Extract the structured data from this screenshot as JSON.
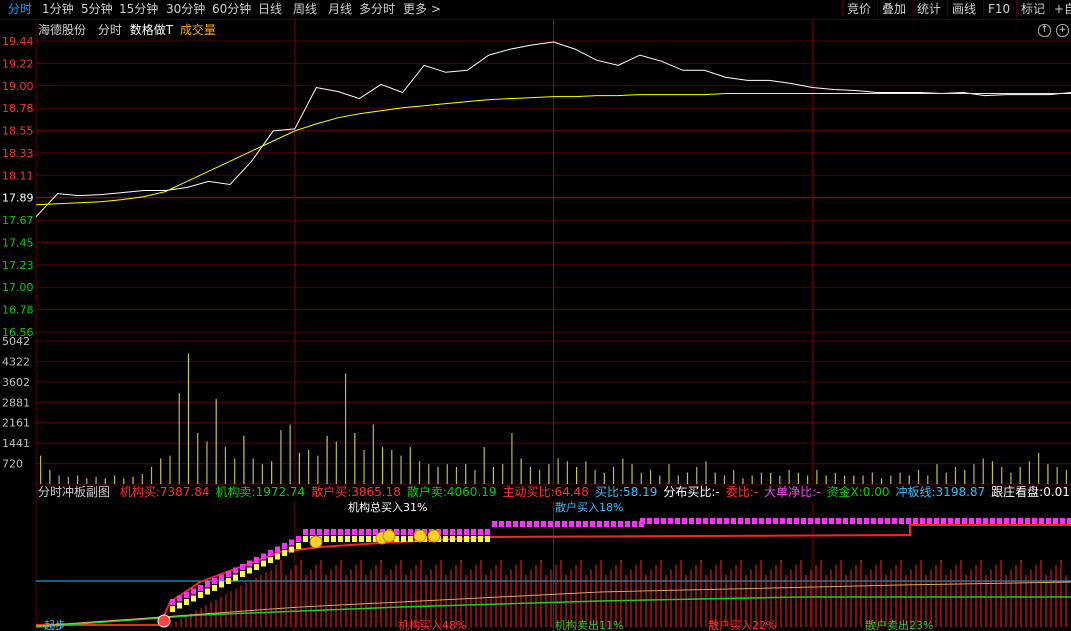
{
  "toolbar": {
    "tabs": [
      {
        "label": "分时",
        "active": true
      },
      {
        "label": "1分钟"
      },
      {
        "label": "5分钟"
      },
      {
        "label": "15分钟"
      },
      {
        "label": "30分钟"
      },
      {
        "label": "60分钟"
      },
      {
        "label": "日线"
      },
      {
        "label": "周线"
      },
      {
        "label": "月线"
      },
      {
        "label": "多分时"
      },
      {
        "label": "更多 >"
      }
    ],
    "right_buttons": [
      {
        "label": "竞价"
      },
      {
        "label": "叠加"
      },
      {
        "label": "统计"
      },
      {
        "label": "画线"
      },
      {
        "label": "F10"
      },
      {
        "label": "标记"
      },
      {
        "label": "+自"
      }
    ]
  },
  "header": {
    "stock_name": "海德股份",
    "mode": "分时",
    "indicator": "数格做T",
    "volume_label": "成交量",
    "button_up": "↑",
    "button_plus": "+"
  },
  "price_axis": [
    "19.44",
    "19.22",
    "19.00",
    "18.78",
    "18.55",
    "18.33",
    "18.11",
    "17.89",
    "17.67",
    "17.45",
    "17.23",
    "17.00",
    "16.78",
    "16.56"
  ],
  "volume_axis": [
    "5042",
    "4322",
    "3602",
    "2881",
    "2161",
    "1441",
    "720"
  ],
  "sub_header": {
    "title": "分时冲板副图",
    "items": [
      {
        "label": "机构买:",
        "value": "7387.84",
        "color": "#ff3030"
      },
      {
        "label": "机构卖:",
        "value": "1972.74",
        "color": "#00d000"
      },
      {
        "label": "散户买:",
        "value": "3865.18",
        "color": "#ff3030"
      },
      {
        "label": "散户卖:",
        "value": "4060.19",
        "color": "#00d000"
      },
      {
        "label": "主动买比:",
        "value": "64.48",
        "color": "#ff3030"
      },
      {
        "label": "买比:",
        "value": "58.19",
        "color": "#30c0ff"
      },
      {
        "label": "分布买比:",
        "value": "-",
        "color": "#ffffff"
      },
      {
        "label": "委比:",
        "value": "-",
        "color": "#ff3030"
      },
      {
        "label": "大单净比:",
        "value": "-",
        "color": "#ff40ff"
      },
      {
        "label": "资金X:",
        "value": "0.00",
        "color": "#00d000"
      },
      {
        "label": "冲板线:",
        "value": "3198.87",
        "color": "#30c0ff"
      },
      {
        "label": "跟庄看盘:",
        "value": "0.01",
        "color": "#ffffff"
      },
      {
        "label": "主力",
        "value": "",
        "color": "#ff40ff"
      }
    ]
  },
  "annotations": {
    "inst_total_buy": "机构总买入31%",
    "retail_total_buy": "散户买入18%",
    "inst_buy": "机构买入48%",
    "inst_sell": "机构卖出11%",
    "retail_buy": "散户买入22%",
    "retail_sell": "散户卖出23%",
    "start_label": "起步"
  },
  "chart_data": [
    {
      "type": "line",
      "name": "intraday-price",
      "ylim": [
        16.56,
        19.44
      ],
      "prev_close": 17.89,
      "x": [
        0,
        5,
        10,
        15,
        20,
        25,
        30,
        35,
        40,
        45,
        50,
        55,
        60,
        65,
        70,
        75,
        80,
        85,
        90,
        95,
        100,
        105,
        110,
        115,
        120,
        125,
        130,
        135,
        140,
        145,
        150,
        155,
        160,
        165,
        170,
        175,
        180,
        185,
        190,
        195,
        200,
        205,
        210,
        215,
        220,
        225,
        230,
        235,
        240
      ],
      "series": [
        {
          "values": [
            17.7,
            17.93,
            17.91,
            17.92,
            17.94,
            17.96,
            17.96,
            17.99,
            18.05,
            18.02,
            18.25,
            18.55,
            18.57,
            18.98,
            18.94,
            18.87,
            19.01,
            18.93,
            19.2,
            19.13,
            19.15,
            19.3,
            19.36,
            19.4,
            19.43,
            19.36,
            19.25,
            19.2,
            19.3,
            19.24,
            19.15,
            19.15,
            19.08,
            19.05,
            19.05,
            19.02,
            18.98,
            18.96,
            18.95,
            18.93,
            18.93,
            18.93,
            18.92,
            18.93,
            18.9,
            18.91,
            18.91,
            18.91,
            18.93
          ],
          "color": "#ffffff"
        },
        {
          "values": [
            17.82,
            17.83,
            17.84,
            17.85,
            17.87,
            17.9,
            17.95,
            18.05,
            18.15,
            18.25,
            18.35,
            18.45,
            18.55,
            18.62,
            18.68,
            18.72,
            18.75,
            18.78,
            18.8,
            18.82,
            18.84,
            18.86,
            18.87,
            18.88,
            18.89,
            18.89,
            18.9,
            18.9,
            18.91,
            18.91,
            18.91,
            18.91,
            18.92,
            18.92,
            18.92,
            18.92,
            18.92,
            18.92,
            18.92,
            18.92,
            18.92,
            18.92,
            18.92,
            18.92,
            18.92,
            18.92,
            18.92,
            18.92,
            18.92
          ],
          "color": "#ffff00"
        }
      ]
    },
    {
      "type": "bar",
      "name": "volume",
      "ylim": [
        0,
        5042
      ],
      "values": [
        1000,
        500,
        300,
        250,
        300,
        200,
        250,
        200,
        300,
        200,
        250,
        350,
        600,
        900,
        1000,
        3200,
        4600,
        1800,
        1500,
        3000,
        1300,
        900,
        1700,
        900,
        700,
        800,
        1900,
        2100,
        1100,
        1200,
        1000,
        1700,
        1500,
        3900,
        1800,
        1200,
        2100,
        1300,
        1200,
        1000,
        1300,
        800,
        700,
        600,
        700,
        600,
        700,
        500,
        1300,
        600,
        700,
        1800,
        900,
        600,
        500,
        700,
        900,
        800,
        600,
        800,
        500,
        400,
        600,
        900,
        700,
        400,
        500,
        300,
        700,
        300,
        400,
        600,
        800,
        400,
        300,
        500,
        200,
        300,
        400,
        400,
        300,
        500,
        400,
        300,
        500,
        300,
        400,
        300,
        300,
        300,
        400,
        200,
        300,
        400,
        300,
        500,
        300,
        700,
        400,
        600,
        500,
        700,
        900,
        800,
        600,
        400,
        600,
        800,
        1100,
        700,
        600,
        500
      ]
    },
    {
      "type": "line",
      "name": "sub-indicator",
      "series": [
        {
          "name": "冲板线",
          "values": [
            3198.87
          ],
          "color": "#30c0ff"
        }
      ]
    }
  ],
  "colors": {
    "grid": "#5a0000",
    "cross": "#b00000",
    "up": "#ff3030",
    "down": "#00d000",
    "price": "#ffffff",
    "avg": "#ffff00"
  }
}
